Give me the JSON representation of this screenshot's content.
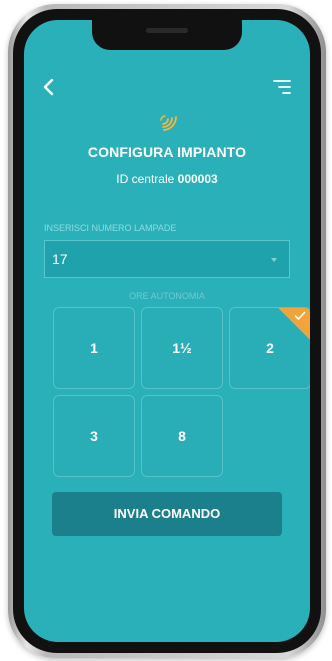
{
  "header": {
    "back_icon": "chevron-left-icon",
    "menu_icon": "menu-lines-icon",
    "signal_icon": "wireless-signal-icon",
    "title": "CONFIGURA IMPIANTO",
    "subtitle_prefix": "ID centrale",
    "central_id": "000003"
  },
  "form": {
    "lamps_label": "INSERISCI NUMERO LAMPADE",
    "lamps_value": "17",
    "autonomy_label": "ORE AUTONOMIA",
    "autonomy_options": [
      {
        "label": "1",
        "selected": false
      },
      {
        "label": "1½",
        "selected": false
      },
      {
        "label": "2",
        "selected": true
      },
      {
        "label": "3",
        "selected": false
      },
      {
        "label": "8",
        "selected": false
      }
    ],
    "submit_label": "INVIA COMANDO"
  },
  "colors": {
    "screen_bg": "#2ab0b9",
    "button_bg": "#1b7f8c",
    "selected_badge": "#f0a43a",
    "signal_icon": "#f5b73b"
  }
}
